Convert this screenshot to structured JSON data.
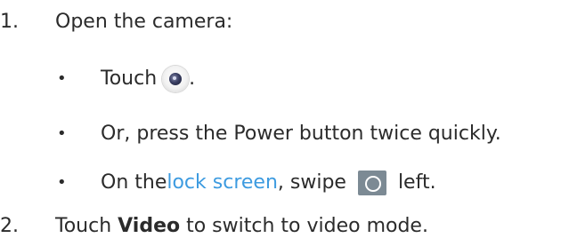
{
  "steps": [
    {
      "number": "1.",
      "text": "Open the camera:"
    },
    {
      "number": "2.",
      "prefix": "Touch ",
      "bold": "Video",
      "suffix": " to switch to video mode."
    }
  ],
  "bullets": [
    {
      "marker": "•",
      "prefix": "Touch ",
      "icon": "camera-app-icon",
      "suffix": "."
    },
    {
      "marker": "•",
      "text": "Or, press the Power button twice quickly."
    },
    {
      "marker": "•",
      "prefix": "On the ",
      "link": "lock screen",
      "middle": ", swipe ",
      "icon": "lock-screen-camera-icon",
      "suffix": " left."
    }
  ],
  "colors": {
    "text": "#2b2b2b",
    "link": "#3d9be0",
    "lock_icon_bg": "#7c8a94"
  }
}
